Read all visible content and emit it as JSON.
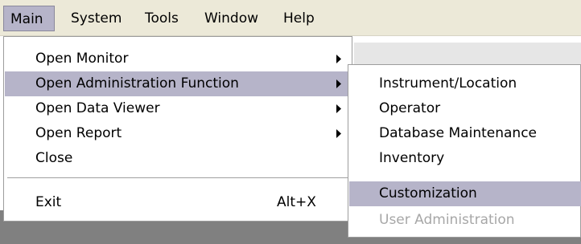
{
  "menubar": {
    "items": [
      {
        "label": "Main",
        "active": true
      },
      {
        "label": "System",
        "active": false
      },
      {
        "label": "Tools",
        "active": false
      },
      {
        "label": "Window",
        "active": false
      },
      {
        "label": "Help",
        "active": false
      }
    ]
  },
  "main_menu": {
    "items": [
      {
        "label": "Open Monitor",
        "has_submenu": true
      },
      {
        "label": "Open Administration Function",
        "has_submenu": true,
        "highlighted": true
      },
      {
        "label": "Open Data Viewer",
        "has_submenu": true
      },
      {
        "label": "Open Report",
        "has_submenu": true
      },
      {
        "label": "Close",
        "has_submenu": false
      }
    ],
    "exit": {
      "label": "Exit",
      "shortcut": "Alt+X"
    }
  },
  "admin_submenu": {
    "items": [
      {
        "label": "Instrument/Location",
        "enabled": true
      },
      {
        "label": "Operator",
        "enabled": true
      },
      {
        "label": "Database Maintenance",
        "enabled": true
      },
      {
        "label": "Inventory",
        "enabled": true
      },
      {
        "label": "Customization",
        "enabled": true,
        "highlighted": true
      },
      {
        "label": "User Administration",
        "enabled": false
      }
    ]
  },
  "icons": {
    "submenu_arrow": "submenu-arrow-icon"
  },
  "colors": {
    "menubar_bg": "#ece9d8",
    "highlight": "#b6b4c9",
    "disabled_text": "#a7a7a7",
    "backdrop": "#808080"
  }
}
